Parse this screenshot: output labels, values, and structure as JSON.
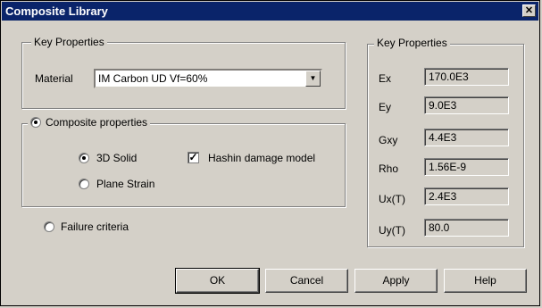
{
  "window": {
    "title": "Composite Library",
    "close_glyph": "✕"
  },
  "material_group": {
    "legend": "Key Properties",
    "material_label": "Material",
    "material_value": "IM Carbon UD Vf=60%"
  },
  "composite_group": {
    "legend": "Composite properties",
    "selected": true,
    "solid_3d": {
      "label": "3D Solid",
      "selected": true
    },
    "plane_strain": {
      "label": "Plane Strain",
      "selected": false
    },
    "hashin": {
      "label": "Hashin damage model",
      "checked": true
    }
  },
  "failure_criteria": {
    "label": "Failure criteria",
    "selected": false
  },
  "properties": {
    "legend": "Key Properties",
    "rows": [
      {
        "label": "Ex",
        "value": "170.0E3"
      },
      {
        "label": "Ey",
        "value": "9.0E3"
      },
      {
        "label": "Gxy",
        "value": "4.4E3"
      },
      {
        "label": "Rho",
        "value": "1.56E-9"
      },
      {
        "label": "Ux(T)",
        "value": "2.4E3"
      },
      {
        "label": "Uy(T)",
        "value": "80.0"
      }
    ]
  },
  "buttons": {
    "ok": "OK",
    "cancel": "Cancel",
    "apply": "Apply",
    "help": "Help"
  }
}
